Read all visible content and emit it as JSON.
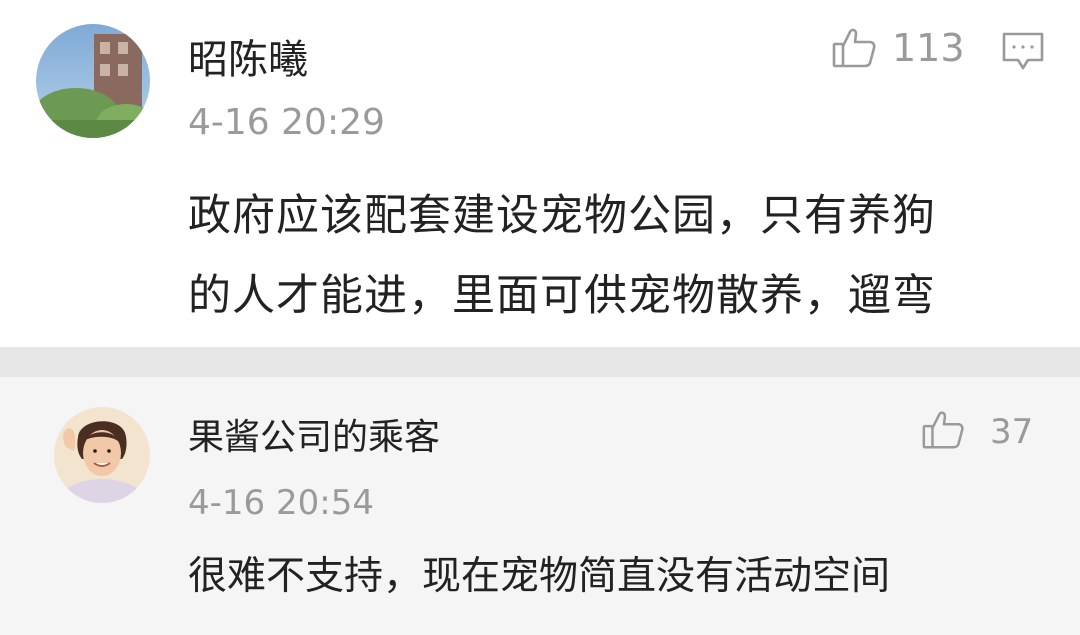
{
  "comments": [
    {
      "username": "昭陈曦",
      "timestamp": "4-16 20:29",
      "like_count": "113",
      "content_lines": [
        "政府应该配套建设宠物公园，只有养狗",
        "的人才能进，里面可供宠物散养，遛弯"
      ],
      "icons": [
        "thumbs-up-icon",
        "reply-comment-icon"
      ]
    },
    {
      "username": "果酱公司的乘客",
      "timestamp": "4-16 20:54",
      "like_count": "37",
      "content": "很难不支持，现在宠物简直没有活动空间",
      "icons": [
        "thumbs-up-icon"
      ]
    }
  ],
  "colors": {
    "text_primary": "#222222",
    "text_secondary": "#9a9a9a",
    "card_primary_bg": "#ffffff",
    "card_secondary_bg": "#f5f5f5",
    "divider": "#e6e6e6"
  }
}
